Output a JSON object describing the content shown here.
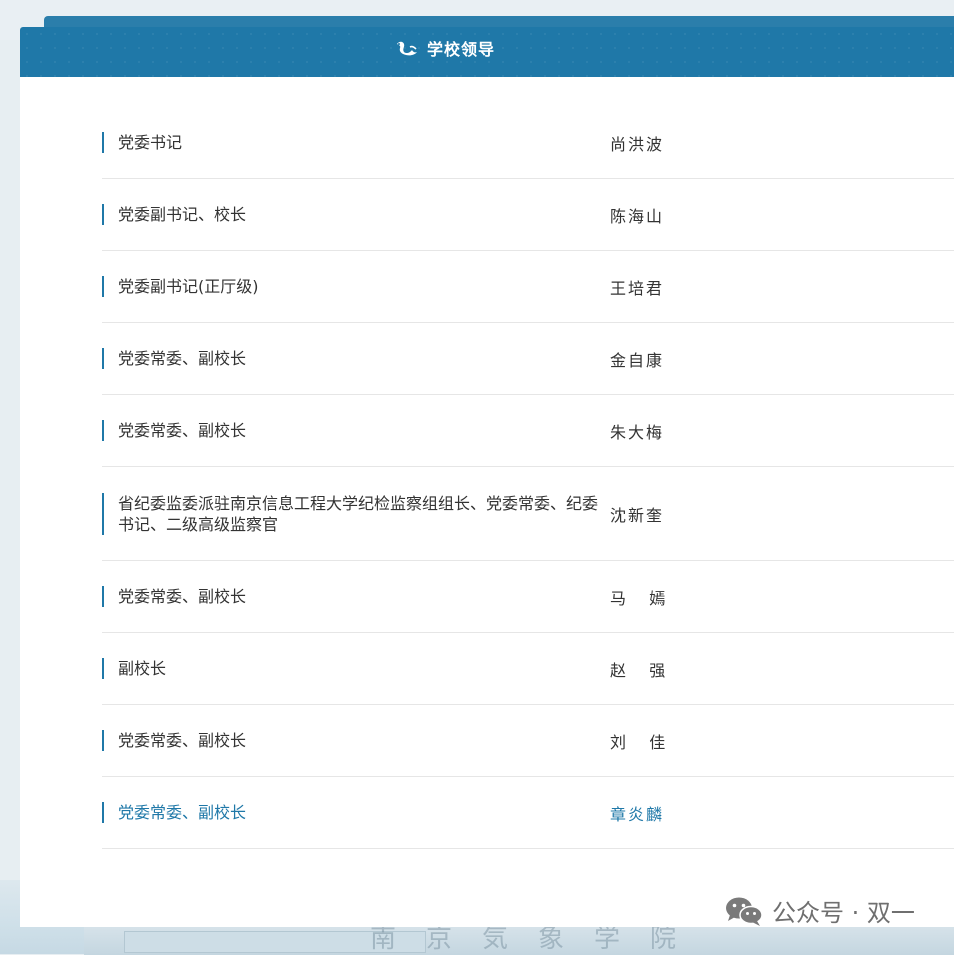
{
  "header": {
    "title": "学校领导",
    "icon": "crane-icon"
  },
  "leaders": [
    {
      "role": "党委书记",
      "name": "尚洪波"
    },
    {
      "role": "党委副书记、校长",
      "name": "陈海山"
    },
    {
      "role": "党委副书记(正厅级)",
      "name": "王培君"
    },
    {
      "role": "党委常委、副校长",
      "name": "金自康"
    },
    {
      "role": "党委常委、副校长",
      "name": "朱大梅"
    },
    {
      "role": "省纪委监委派驻南京信息工程大学纪检监察组组长、党委常委、纪委书记、二级高级监察官",
      "name": "沈新奎"
    },
    {
      "role": "党委常委、副校长",
      "name": "马   嫣"
    },
    {
      "role": "副校长",
      "name": "赵   强"
    },
    {
      "role": "党委常委、副校长",
      "name": "刘   佳"
    },
    {
      "role": "党委常委、副校长",
      "name": "章炎麟"
    }
  ],
  "watermark": {
    "text": "公众号 · 双一",
    "icon": "wechat-icon"
  },
  "background": {
    "engraving": "南京気象学院"
  },
  "colors": {
    "accent": "#1f78a8",
    "divider": "#e6e6e6",
    "text": "#333333"
  }
}
